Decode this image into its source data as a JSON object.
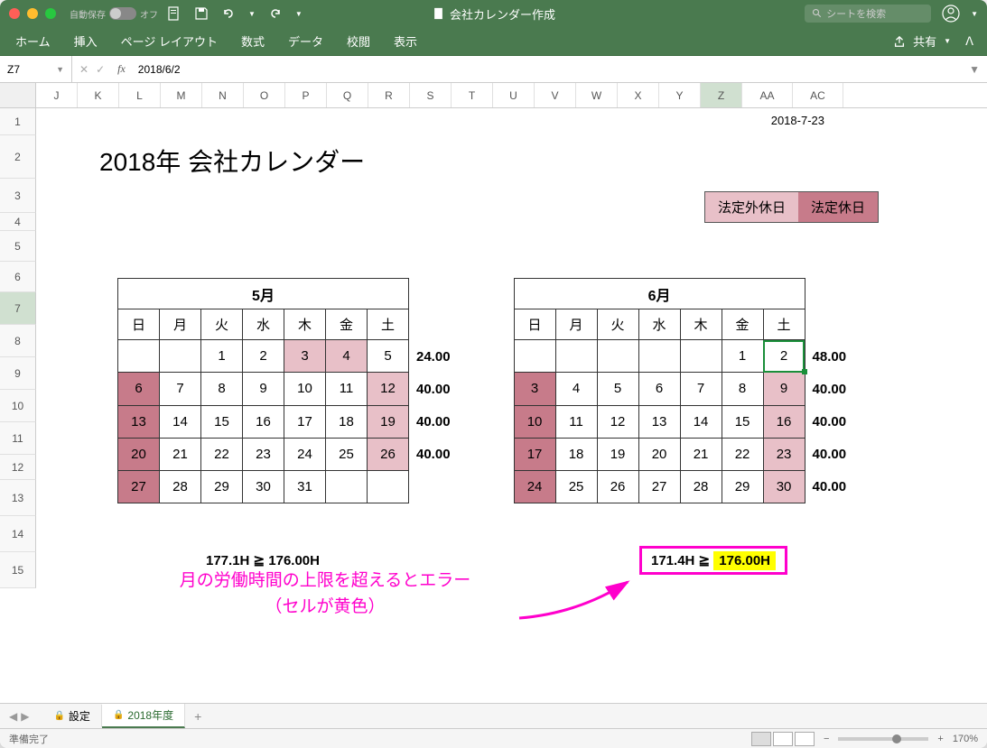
{
  "titlebar": {
    "autosave_label": "自動保存",
    "autosave_state": "オフ",
    "doc_title": "会社カレンダー作成",
    "search_placeholder": "シートを検索"
  },
  "tabs": {
    "home": "ホーム",
    "insert": "挿入",
    "page_layout": "ページ レイアウト",
    "formulas": "数式",
    "data": "データ",
    "review": "校閲",
    "view": "表示",
    "share": "共有"
  },
  "namebox": {
    "cell": "Z7",
    "formula": "2018/6/2"
  },
  "columns": [
    "J",
    "K",
    "L",
    "M",
    "N",
    "O",
    "P",
    "Q",
    "R",
    "S",
    "T",
    "U",
    "V",
    "W",
    "X",
    "Y",
    "Z",
    "AA",
    "AC"
  ],
  "active_col": "Z",
  "rows": [
    "1",
    "2",
    "3",
    "4",
    "5",
    "6",
    "7",
    "8",
    "9",
    "10",
    "11",
    "12",
    "13",
    "14",
    "15"
  ],
  "active_row": "7",
  "sheet": {
    "date_stamp": "2018-7-23",
    "title": "2018年 会社カレンダー",
    "legend_extra": "法定外休日",
    "legend_legal": "法定休日"
  },
  "calendar_may": {
    "month": "5月",
    "days": [
      "日",
      "月",
      "火",
      "水",
      "木",
      "金",
      "土"
    ],
    "rows": [
      [
        {
          "v": ""
        },
        {
          "v": ""
        },
        {
          "v": "1"
        },
        {
          "v": "2"
        },
        {
          "v": "3",
          "c": "holiday-extra"
        },
        {
          "v": "4",
          "c": "holiday-extra"
        },
        {
          "v": "5"
        }
      ],
      [
        {
          "v": "6",
          "c": "holiday-legal"
        },
        {
          "v": "7"
        },
        {
          "v": "8"
        },
        {
          "v": "9"
        },
        {
          "v": "10"
        },
        {
          "v": "11"
        },
        {
          "v": "12",
          "c": "holiday-extra"
        }
      ],
      [
        {
          "v": "13",
          "c": "holiday-legal"
        },
        {
          "v": "14"
        },
        {
          "v": "15"
        },
        {
          "v": "16"
        },
        {
          "v": "17"
        },
        {
          "v": "18"
        },
        {
          "v": "19",
          "c": "holiday-extra"
        }
      ],
      [
        {
          "v": "20",
          "c": "holiday-legal"
        },
        {
          "v": "21"
        },
        {
          "v": "22"
        },
        {
          "v": "23"
        },
        {
          "v": "24"
        },
        {
          "v": "25"
        },
        {
          "v": "26",
          "c": "holiday-extra"
        }
      ],
      [
        {
          "v": "27",
          "c": "holiday-legal"
        },
        {
          "v": "28"
        },
        {
          "v": "29"
        },
        {
          "v": "30"
        },
        {
          "v": "31"
        },
        {
          "v": ""
        },
        {
          "v": ""
        }
      ]
    ],
    "hours": [
      "24.00",
      "40.00",
      "40.00",
      "40.00",
      ""
    ],
    "summary": "177.1H ≧ 176.00H"
  },
  "calendar_jun": {
    "month": "6月",
    "days": [
      "日",
      "月",
      "火",
      "水",
      "木",
      "金",
      "土"
    ],
    "rows": [
      [
        {
          "v": ""
        },
        {
          "v": ""
        },
        {
          "v": ""
        },
        {
          "v": ""
        },
        {
          "v": ""
        },
        {
          "v": "1"
        },
        {
          "v": "2",
          "sel": true
        }
      ],
      [
        {
          "v": "3",
          "c": "holiday-legal"
        },
        {
          "v": "4"
        },
        {
          "v": "5"
        },
        {
          "v": "6"
        },
        {
          "v": "7"
        },
        {
          "v": "8"
        },
        {
          "v": "9",
          "c": "holiday-extra"
        }
      ],
      [
        {
          "v": "10",
          "c": "holiday-legal"
        },
        {
          "v": "11"
        },
        {
          "v": "12"
        },
        {
          "v": "13"
        },
        {
          "v": "14"
        },
        {
          "v": "15"
        },
        {
          "v": "16",
          "c": "holiday-extra"
        }
      ],
      [
        {
          "v": "17",
          "c": "holiday-legal"
        },
        {
          "v": "18"
        },
        {
          "v": "19"
        },
        {
          "v": "20"
        },
        {
          "v": "21"
        },
        {
          "v": "22"
        },
        {
          "v": "23",
          "c": "holiday-extra"
        }
      ],
      [
        {
          "v": "24",
          "c": "holiday-legal"
        },
        {
          "v": "25"
        },
        {
          "v": "26"
        },
        {
          "v": "27"
        },
        {
          "v": "28"
        },
        {
          "v": "29"
        },
        {
          "v": "30",
          "c": "holiday-extra"
        }
      ]
    ],
    "hours": [
      "48.00",
      "40.00",
      "40.00",
      "40.00",
      "40.00"
    ],
    "summary_left": "171.4H ≧ ",
    "summary_right": "176.00H"
  },
  "annotation": {
    "line1": "月の労働時間の上限を超えるとエラー",
    "line2": "（セルが黄色）"
  },
  "sheet_tabs": {
    "tab1": "設定",
    "tab2": "2018年度"
  },
  "statusbar": {
    "status": "準備完了",
    "zoom": "170%"
  }
}
